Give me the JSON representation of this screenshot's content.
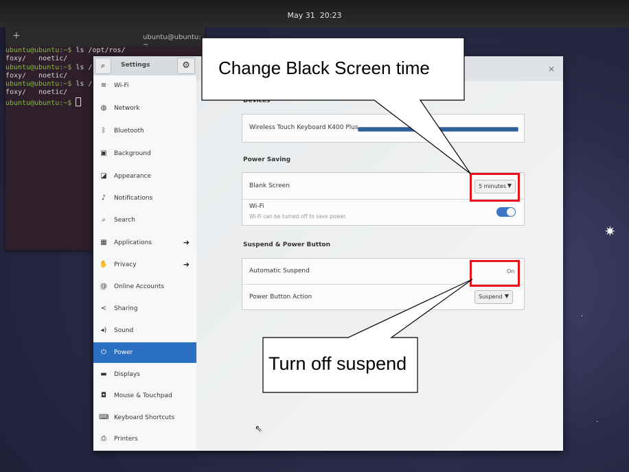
{
  "topbar": {
    "date": "May 31",
    "time": "20:23"
  },
  "terminal": {
    "title": "ubuntu@ubuntu: ~",
    "lines": [
      {
        "prompt": "ubuntu@ubuntu:~$",
        "cmd": " ls /opt/ros/"
      },
      {
        "prompt": "",
        "cmd": "foxy/   noetic/"
      },
      {
        "prompt": "ubuntu@ubuntu:~$",
        "cmd": " ls /"
      },
      {
        "prompt": "",
        "cmd": "foxy/   noetic/"
      },
      {
        "prompt": "ubuntu@ubuntu:~$",
        "cmd": " ls /"
      },
      {
        "prompt": "",
        "cmd": "foxy/   noetic/"
      },
      {
        "prompt": "ubuntu@ubuntu:~$",
        "cmd": " "
      }
    ]
  },
  "settings": {
    "sidebar_title": "Settings",
    "sidebar_items": [
      {
        "label": "Wi-Fi",
        "icon": "wifi-icon",
        "glyph": "≋",
        "arrow": false,
        "active": false
      },
      {
        "label": "Network",
        "icon": "network-icon",
        "glyph": "◍",
        "arrow": false,
        "active": false
      },
      {
        "label": "Bluetooth",
        "icon": "bluetooth-icon",
        "glyph": "ᛒ",
        "arrow": false,
        "active": false
      },
      {
        "label": "Background",
        "icon": "background-icon",
        "glyph": "▣",
        "arrow": false,
        "active": false
      },
      {
        "label": "Appearance",
        "icon": "appearance-icon",
        "glyph": "◪",
        "arrow": false,
        "active": false
      },
      {
        "label": "Notifications",
        "icon": "bell-icon",
        "glyph": "♪",
        "arrow": false,
        "active": false
      },
      {
        "label": "Search",
        "icon": "search-icon",
        "glyph": "⌕",
        "arrow": false,
        "active": false
      },
      {
        "label": "Applications",
        "icon": "applications-icon",
        "glyph": "▦",
        "arrow": true,
        "active": false
      },
      {
        "label": "Privacy",
        "icon": "hand-icon",
        "glyph": "✋",
        "arrow": true,
        "active": false
      },
      {
        "label": "Online Accounts",
        "icon": "at-icon",
        "glyph": "@",
        "arrow": false,
        "active": false
      },
      {
        "label": "Sharing",
        "icon": "share-icon",
        "glyph": "<",
        "arrow": false,
        "active": false
      },
      {
        "label": "Sound",
        "icon": "speaker-icon",
        "glyph": "◂)",
        "arrow": false,
        "active": false
      },
      {
        "label": "Power",
        "icon": "power-icon",
        "glyph": "⏻",
        "arrow": false,
        "active": true
      },
      {
        "label": "Displays",
        "icon": "display-icon",
        "glyph": "▬",
        "arrow": false,
        "active": false
      },
      {
        "label": "Mouse & Touchpad",
        "icon": "mouse-icon",
        "glyph": "◘",
        "arrow": false,
        "active": false
      },
      {
        "label": "Keyboard Shortcuts",
        "icon": "keyboard-icon",
        "glyph": "⌨",
        "arrow": false,
        "active": false
      },
      {
        "label": "Printers",
        "icon": "printer-icon",
        "glyph": "⎙",
        "arrow": false,
        "active": false
      }
    ],
    "devices": {
      "title": "Devices",
      "item_label": "Wireless Touch Keyboard K400 Plus",
      "battery_level": 1.0
    },
    "power_saving": {
      "title": "Power Saving",
      "blank_screen_label": "Blank Screen",
      "blank_screen_value": "5 minutes",
      "wifi_label": "Wi-Fi",
      "wifi_sub": "Wi-Fi can be turned off to save power.",
      "wifi_on": true
    },
    "suspend": {
      "title": "Suspend & Power Button",
      "auto_suspend_label": "Automatic Suspend",
      "auto_suspend_value": "On",
      "power_button_label": "Power Button Action",
      "power_button_value": "Suspend"
    }
  },
  "annotations": {
    "callout_top": "Change Black Screen time",
    "callout_bottom": "Turn off suspend",
    "highlight_color": "#e8141b"
  }
}
